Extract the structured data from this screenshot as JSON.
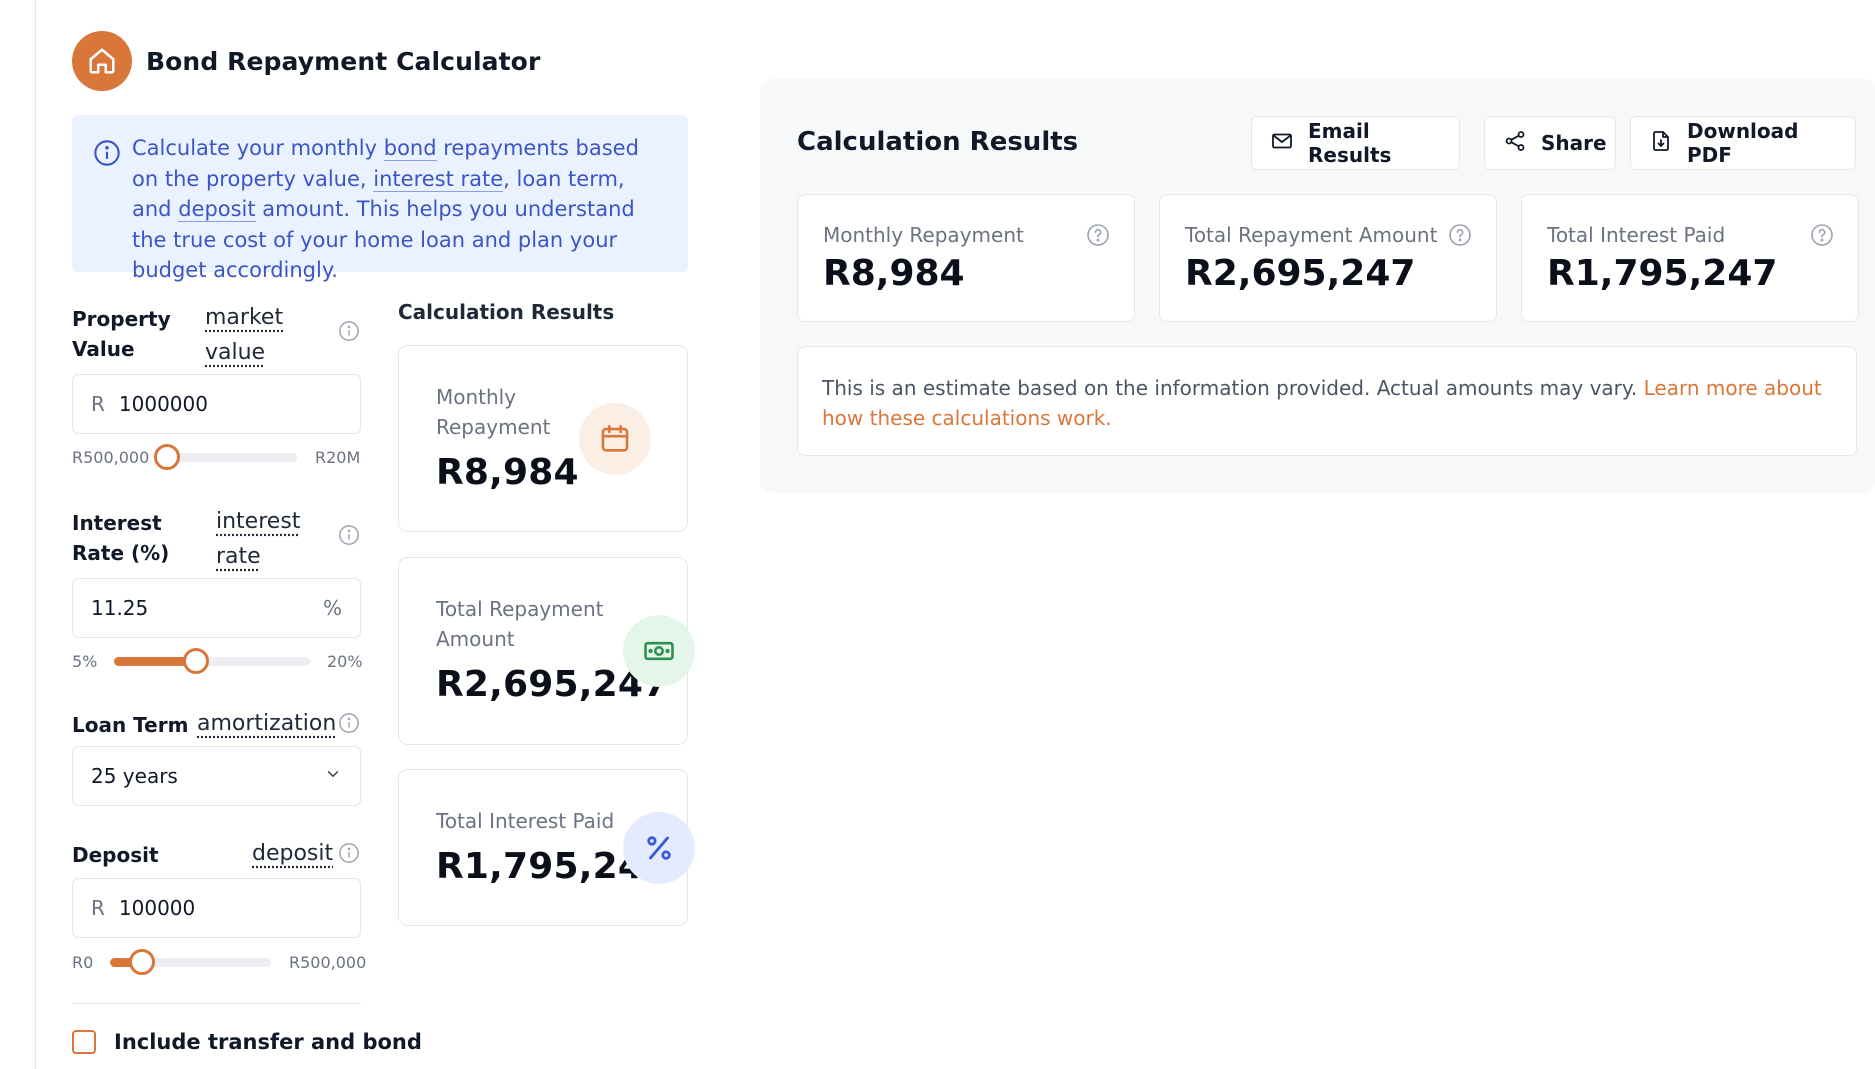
{
  "app": {
    "title": "Bond Repayment Calculator"
  },
  "info": {
    "segments": [
      {
        "text": "Calculate your monthly ",
        "term": false
      },
      {
        "text": "bond",
        "term": true
      },
      {
        "text": " repayments based on the property value, ",
        "term": false
      },
      {
        "text": "interest rate",
        "term": true
      },
      {
        "text": ", loan term, and ",
        "term": false
      },
      {
        "text": "deposit",
        "term": true
      },
      {
        "text": " amount. This helps you understand the true cost of your home loan and plan your budget accordingly.",
        "term": false
      }
    ]
  },
  "form": {
    "property": {
      "label": "Property Value",
      "term": "market value",
      "prefix": "R",
      "value": "1000000",
      "min_label": "R500,000",
      "max_label": "R20M",
      "slider_fraction": 0.03
    },
    "interest": {
      "label": "Interest Rate (%)",
      "term": "interest rate",
      "value": "11.25",
      "suffix": "%",
      "min_label": "5%",
      "max_label": "20%",
      "slider_fraction": 0.42
    },
    "loan_term": {
      "label": "Loan Term",
      "term": "amortization",
      "value": "25 years"
    },
    "deposit": {
      "label": "Deposit",
      "term": "deposit",
      "prefix": "R",
      "value": "100000",
      "min_label": "R0",
      "max_label": "R500,000",
      "slider_fraction": 0.2
    },
    "include_costs": {
      "label": "Include transfer and bond",
      "checked": false
    }
  },
  "summary": {
    "title": "Calculation Results",
    "monthly": {
      "label": "Monthly Repayment",
      "value": "R8,984",
      "icon": "calendar-icon"
    },
    "total": {
      "label": "Total Repayment Amount",
      "value": "R2,695,247",
      "icon": "cash-icon"
    },
    "interest": {
      "label": "Total Interest Paid",
      "value": "R1,795,247",
      "icon": "percent-icon"
    }
  },
  "results": {
    "title": "Calculation Results",
    "actions": {
      "email": "Email Results",
      "share": "Share",
      "download": "Download PDF"
    },
    "cards": [
      {
        "label": "Monthly Repayment",
        "value": "R8,984"
      },
      {
        "label": "Total Repayment Amount",
        "value": "R2,695,247"
      },
      {
        "label": "Total Interest Paid",
        "value": "R1,795,247"
      }
    ],
    "note": "This is an estimate based on the information provided. Actual amounts may vary. ",
    "note_link": "Learn more about how these calculations work."
  },
  "colors": {
    "accent": "#d9773a",
    "info_bg": "#eaf2ff",
    "info_text": "#3b56c4",
    "green_icon": "#2f8f4e",
    "blue_icon": "#3b5bd6"
  }
}
